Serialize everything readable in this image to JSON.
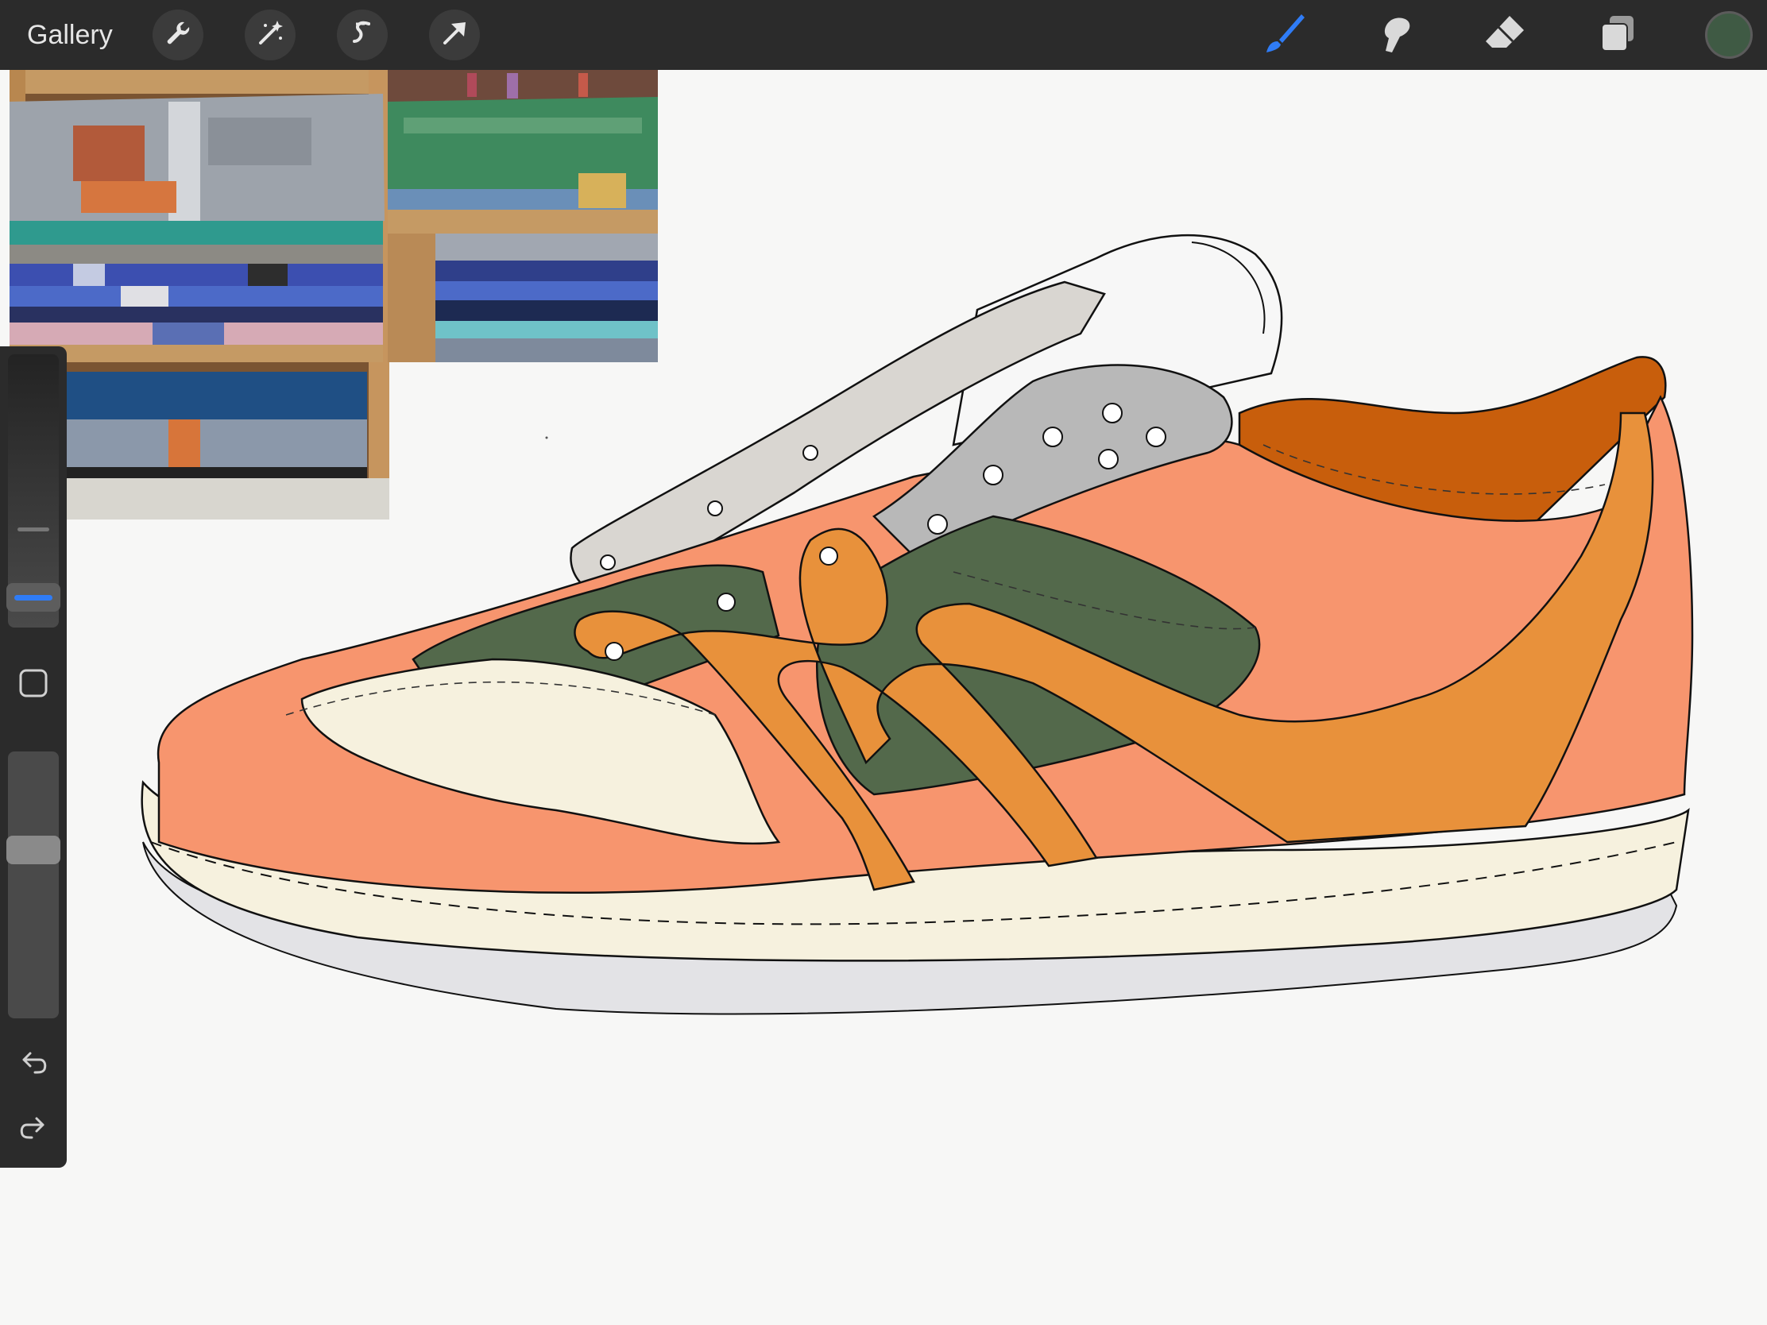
{
  "app": {
    "gallery_label": "Gallery"
  },
  "toolbar": {
    "left_tools": [
      "wrench-icon",
      "magic-wand-icon",
      "selection-icon",
      "transform-arrow-icon"
    ],
    "right_tools": [
      "brush-icon",
      "smudge-icon",
      "eraser-icon",
      "layers-icon"
    ],
    "active_tool": "brush-icon",
    "accent_color": "#2f7cf6",
    "current_color": "#3f5a44"
  },
  "sidebar": {
    "brush_size_level": 0.35,
    "opacity_level": 0.3,
    "modify_button": "square-modify-icon",
    "undo_icon": "undo-icon",
    "redo_icon": "redo-icon"
  },
  "palette": {
    "salmon": "#f7956e",
    "orange": "#e8913b",
    "green": "#53694b",
    "cream": "#f6f1de",
    "gray": "#b8b8b8",
    "rust": "#c85e0c",
    "outsole": "#e3e3e6"
  }
}
